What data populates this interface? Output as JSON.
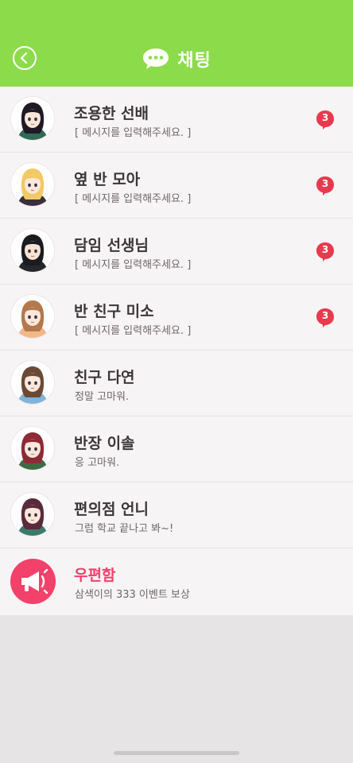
{
  "header": {
    "title": "채팅",
    "bg_color": "#8cdb4b",
    "back_icon": "chevron-left-icon",
    "title_icon": "speech-bubble-icon"
  },
  "chats": [
    {
      "name": "조용한 선배",
      "message": "[ 메시지를 입력해주세요. ]",
      "unread": "3",
      "hair": "#1f1a24",
      "skin": "#fde7da",
      "cloth": "#2f6b55"
    },
    {
      "name": "옆 반 모아",
      "message": "[ 메시지를 입력해주세요. ]",
      "unread": "3",
      "hair": "#f2c964",
      "skin": "#fde7da",
      "cloth": "#3a2f3a"
    },
    {
      "name": "담임 선생님",
      "message": "[ 메시지를 입력해주세요. ]",
      "unread": "3",
      "hair": "#1b1b20",
      "skin": "#fbe3d3",
      "cloth": "#26272d"
    },
    {
      "name": "반 친구 미소",
      "message": "[ 메시지를 입력해주세요. ]",
      "unread": "3",
      "hair": "#b4784e",
      "skin": "#fde7da",
      "cloth": "#f2b88a"
    },
    {
      "name": "친구 다연",
      "message": "정말 고마워.",
      "unread": "",
      "hair": "#6a4a36",
      "skin": "#fde7da",
      "cloth": "#7fb3d8"
    },
    {
      "name": "반장 이솔",
      "message": "응 고마워.",
      "unread": "",
      "hair": "#8e2a36",
      "skin": "#fde7da",
      "cloth": "#3e6b44"
    },
    {
      "name": "편의점 언니",
      "message": "그럼 학교 끝나고 봐~!",
      "unread": "",
      "hair": "#5a2a3a",
      "skin": "#fde7da",
      "cloth": "#3a7a6a"
    }
  ],
  "mailbox": {
    "name": "우편함",
    "message": "삼색이의 333 이벤트 보상",
    "icon": "megaphone-icon",
    "color": "#f2416b"
  },
  "badge_color": "#e83a4f"
}
